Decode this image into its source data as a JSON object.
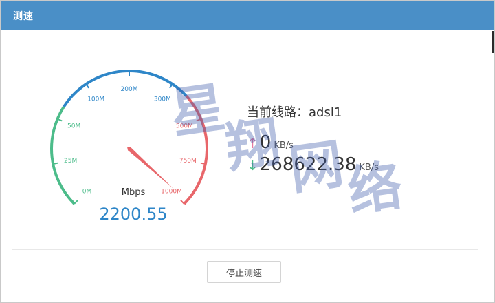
{
  "window": {
    "title": "测速"
  },
  "gauge": {
    "unit": "Mbps",
    "value": "2200.55",
    "needle_position_label": "1000M",
    "ticks": [
      {
        "label": "0M",
        "color": "#4cbc8a"
      },
      {
        "label": "25M",
        "color": "#4cbc8a"
      },
      {
        "label": "50M",
        "color": "#4cbc8a"
      },
      {
        "label": "100M",
        "color": "#2e86c8"
      },
      {
        "label": "200M",
        "color": "#2e86c8"
      },
      {
        "label": "300M",
        "color": "#2e86c8"
      },
      {
        "label": "500M",
        "color": "#e8666a"
      },
      {
        "label": "750M",
        "color": "#e8666a"
      },
      {
        "label": "1000M",
        "color": "#e8666a"
      }
    ],
    "colors": {
      "low": "#4cbc8a",
      "mid": "#2e86c8",
      "high": "#e8666a",
      "needle": "#e8666a"
    }
  },
  "line": {
    "label": "当前线路：adsl1"
  },
  "upload": {
    "arrow": "↑",
    "value": "0",
    "unit": "KB/s"
  },
  "download": {
    "arrow": "↓",
    "value": "268622.38",
    "unit": "KB/s"
  },
  "actions": {
    "stop_label": "停止测速"
  },
  "watermark": {
    "text": [
      "星",
      "翔",
      "网",
      "络"
    ]
  }
}
